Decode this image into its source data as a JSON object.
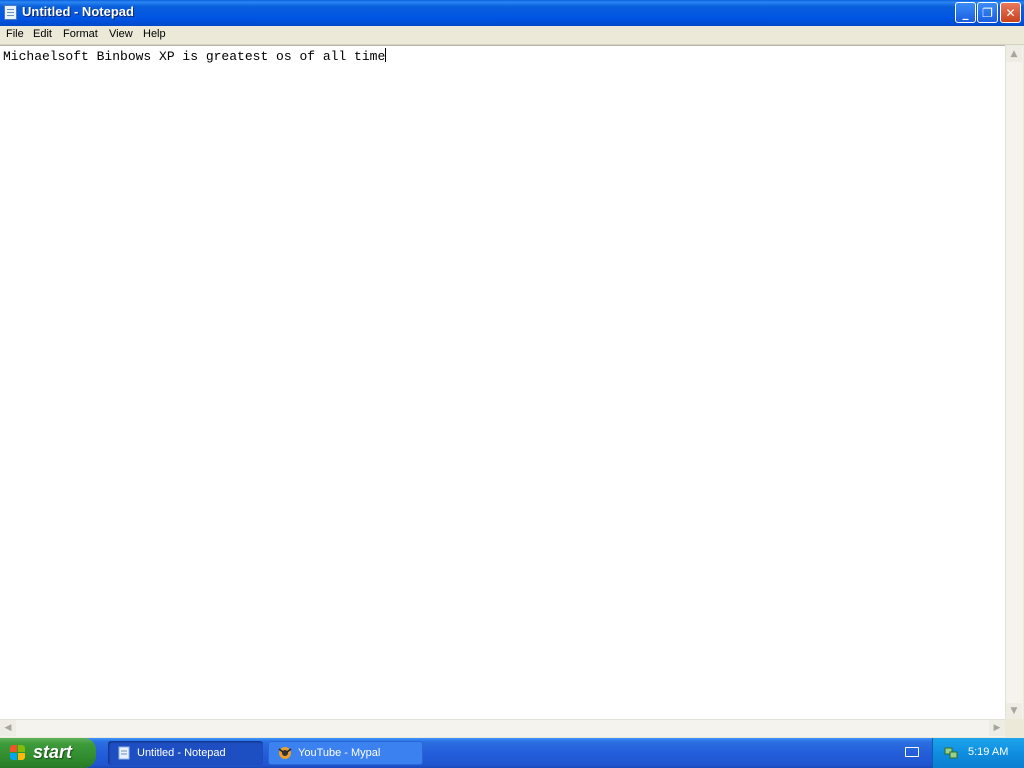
{
  "window": {
    "title": "Untitled - Notepad",
    "buttons": {
      "minimize": "_",
      "maximize": "❐",
      "close": "✕"
    }
  },
  "menu": {
    "items": [
      {
        "label": "File"
      },
      {
        "label": "Edit"
      },
      {
        "label": "Format"
      },
      {
        "label": "View"
      },
      {
        "label": "Help"
      }
    ]
  },
  "editor": {
    "content": "Michaelsoft Binbows XP is greatest os of all time"
  },
  "scrollbars": {
    "up": "▲",
    "down": "▼",
    "left": "◀",
    "right": "▶"
  },
  "taskbar": {
    "start_label": "start",
    "tasks": [
      {
        "label": "Untitled - Notepad",
        "icon": "notepad-icon",
        "active": true
      },
      {
        "label": "YouTube - Mypal",
        "icon": "mypal-browser-icon",
        "active": false
      }
    ],
    "tray": {
      "icons": [
        "keyboard-icon",
        "network-icon"
      ],
      "clock": "5:19 AM"
    }
  },
  "colors": {
    "titlebar": "#0a5fdb",
    "taskbar": "#245edb",
    "start_button": "#3d9b3a",
    "tray": "#0f8ee0"
  }
}
